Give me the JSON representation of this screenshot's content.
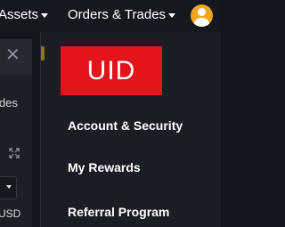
{
  "topnav": {
    "assets_label": "Assets",
    "orders_label": "Orders & Trades",
    "avatar_icon": "user-avatar-icon"
  },
  "colors": {
    "nav_bg": "#15181e",
    "dropdown_bg": "#1a1d24",
    "uid_badge_bg": "#e3141c",
    "avatar_bg": "#f0a623"
  },
  "left_panel": {
    "close_symbol": "✕",
    "sides_text": "ides",
    "usd_text": "USD"
  },
  "dropdown": {
    "uid_label": "UID",
    "items": [
      {
        "label": "Account & Security"
      },
      {
        "label": "My Rewards"
      },
      {
        "label": "Referral Program"
      }
    ]
  }
}
